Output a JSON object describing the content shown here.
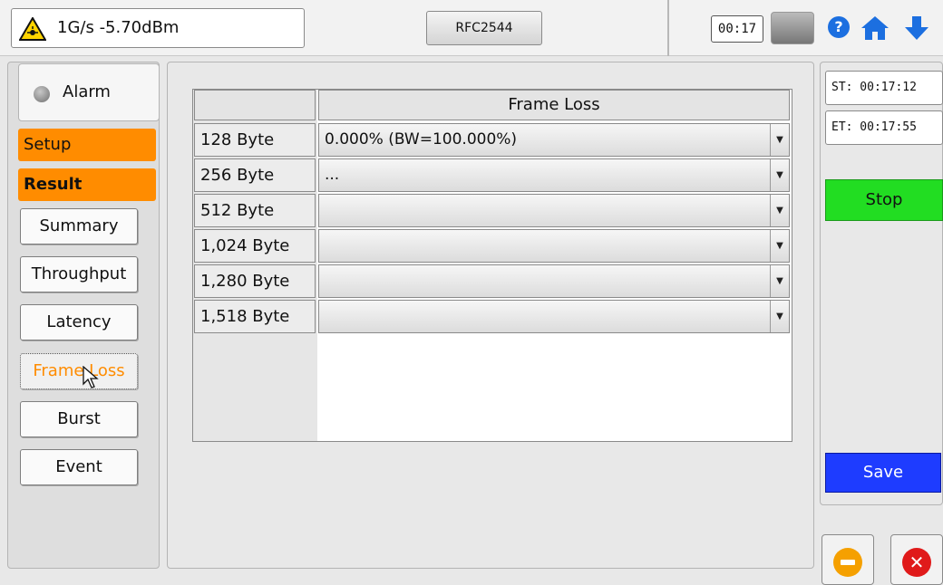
{
  "status": {
    "signal_text": "1G/s -5.70dBm",
    "test_label": "RFC2544",
    "clock": "00:17",
    "icons": {
      "warning": "laser-warning-icon",
      "help": "help-icon",
      "home": "home-icon",
      "download": "download-arrow-icon"
    },
    "help_glyph": "?"
  },
  "alarm": {
    "label": "Alarm"
  },
  "tabs": {
    "setup": "Setup",
    "result": "Result"
  },
  "nav": [
    {
      "id": "summary",
      "label": "Summary"
    },
    {
      "id": "throughput",
      "label": "Throughput"
    },
    {
      "id": "latency",
      "label": "Latency"
    },
    {
      "id": "frame-loss",
      "label": "Frame Loss",
      "active": true
    },
    {
      "id": "burst",
      "label": "Burst"
    },
    {
      "id": "event",
      "label": "Event"
    }
  ],
  "table": {
    "header": "Frame Loss",
    "rows": [
      {
        "label": "128 Byte",
        "value": "0.000% (BW=100.000%)"
      },
      {
        "label": "256 Byte",
        "value": "..."
      },
      {
        "label": "512 Byte",
        "value": ""
      },
      {
        "label": "1,024 Byte",
        "value": ""
      },
      {
        "label": "1,280 Byte",
        "value": ""
      },
      {
        "label": "1,518 Byte",
        "value": ""
      }
    ]
  },
  "times": {
    "start": "ST: 00:17:12",
    "end": "ET: 00:17:55"
  },
  "actions": {
    "stop": "Stop",
    "save": "Save",
    "close_glyph": "✕"
  },
  "colors": {
    "accent_orange": "#ff8c00",
    "stop_green": "#22dd22",
    "save_blue": "#1e3cff",
    "minus_amber": "#f5a000",
    "close_red": "#e01a1a",
    "help_blue": "#1c6fe0"
  }
}
